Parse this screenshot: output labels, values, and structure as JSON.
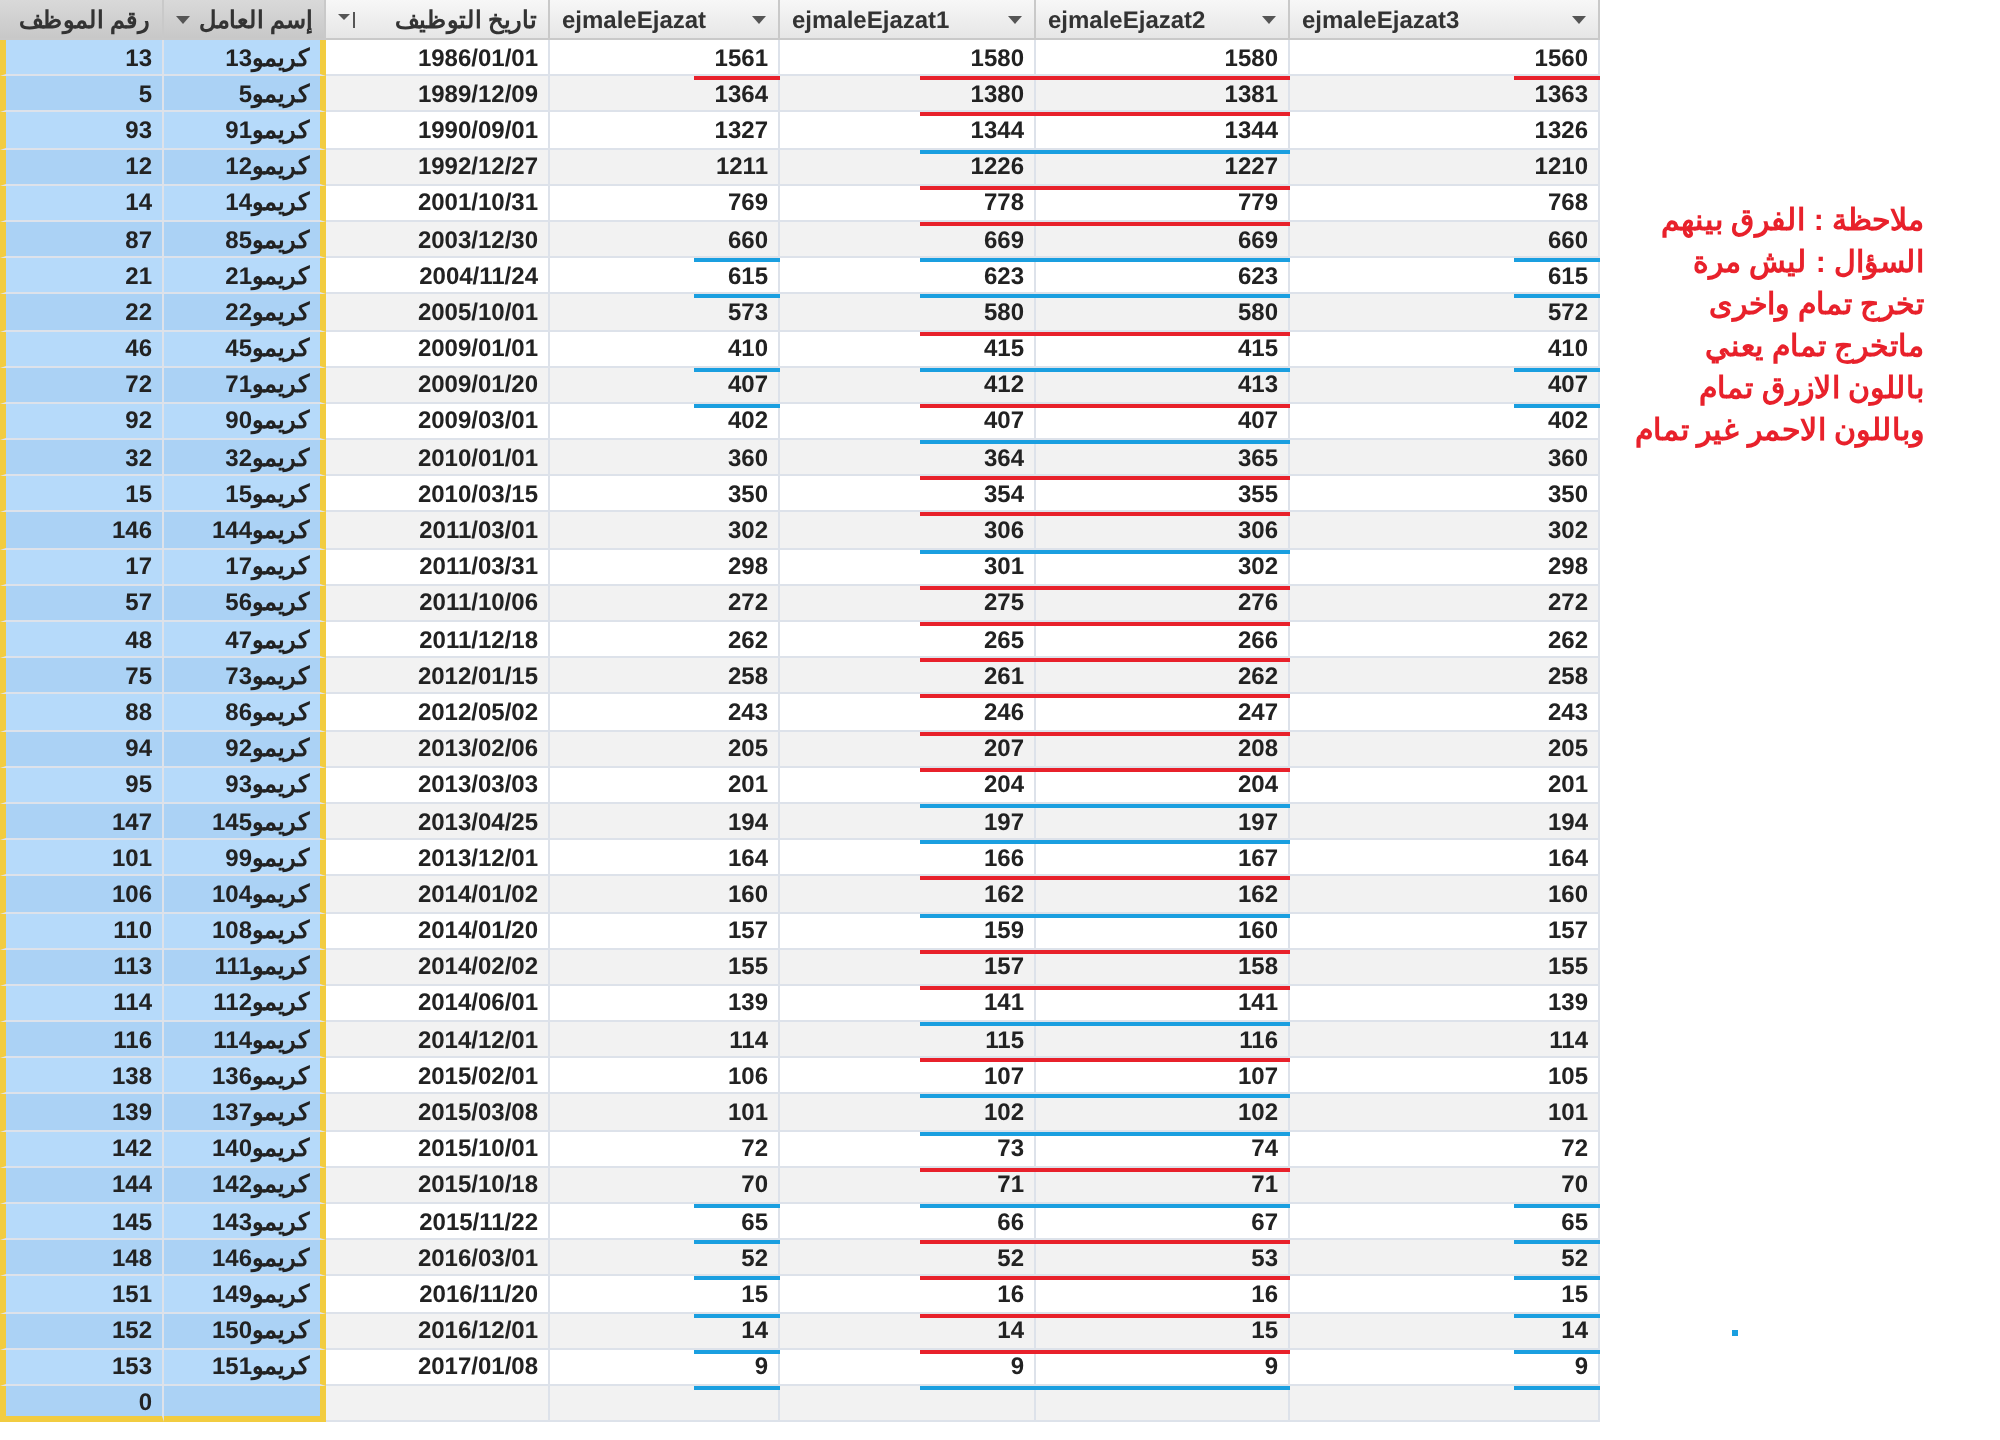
{
  "table": {
    "columns": [
      {
        "label": "رقم الموظف",
        "selected": true
      },
      {
        "label": "إسم العامل",
        "selected": true
      },
      {
        "label": "تاريخ التوظيف",
        "selected": false
      },
      {
        "label": "ejmaleEjazat",
        "selected": false
      },
      {
        "label": "ejmaleEjazat1",
        "selected": false
      },
      {
        "label": "ejmaleEjazat2",
        "selected": false
      },
      {
        "label": "ejmaleEjazat3",
        "selected": false
      }
    ],
    "rows": [
      {
        "cells": [
          "13",
          "كريمو13",
          "1986/01/01",
          "1561",
          "1580",
          "1580",
          "1560"
        ],
        "color": "#e8212b",
        "outer_mark": {
          "color": "#e8212b"
        }
      },
      {
        "cells": [
          "5",
          "كريمو5",
          "1989/12/09",
          "1364",
          "1380",
          "1381",
          "1363"
        ],
        "color": "#e8212b"
      },
      {
        "cells": [
          "93",
          "كريمو91",
          "1990/09/01",
          "1327",
          "1344",
          "1344",
          "1326"
        ],
        "color": "#1a9fe0"
      },
      {
        "cells": [
          "12",
          "كريمو12",
          "1992/12/27",
          "1211",
          "1226",
          "1227",
          "1210"
        ],
        "color": "#e8212b"
      },
      {
        "cells": [
          "14",
          "كريمو14",
          "2001/10/31",
          "769",
          "778",
          "779",
          "768"
        ],
        "color": "#e8212b"
      },
      {
        "cells": [
          "87",
          "كريمو85",
          "2003/12/30",
          "660",
          "669",
          "669",
          "660"
        ],
        "color": "#1a9fe0",
        "outer_mark": {
          "color": "#1a9fe0"
        }
      },
      {
        "cells": [
          "21",
          "كريمو21",
          "2004/11/24",
          "615",
          "623",
          "623",
          "615"
        ],
        "color": "#1a9fe0",
        "outer_mark": {
          "color": "#1a9fe0"
        }
      },
      {
        "cells": [
          "22",
          "كريمو22",
          "2005/10/01",
          "573",
          "580",
          "580",
          "572"
        ],
        "color": "#e8212b"
      },
      {
        "cells": [
          "46",
          "كريمو45",
          "2009/01/01",
          "410",
          "415",
          "415",
          "410"
        ],
        "color": "#1a9fe0",
        "outer_mark": {
          "color": "#1a9fe0"
        }
      },
      {
        "cells": [
          "72",
          "كريمو71",
          "2009/01/20",
          "407",
          "412",
          "413",
          "407"
        ],
        "color": "#e8212b",
        "outer_mark": {
          "color": "#1a9fe0"
        }
      },
      {
        "cells": [
          "92",
          "كريمو90",
          "2009/03/01",
          "402",
          "407",
          "407",
          "402"
        ],
        "color": "#1a9fe0"
      },
      {
        "cells": [
          "32",
          "كريمو32",
          "2010/01/01",
          "360",
          "364",
          "365",
          "360"
        ],
        "color": "#e8212b"
      },
      {
        "cells": [
          "15",
          "كريمو15",
          "2010/03/15",
          "350",
          "354",
          "355",
          "350"
        ],
        "color": "#e8212b"
      },
      {
        "cells": [
          "146",
          "كريمو144",
          "2011/03/01",
          "302",
          "306",
          "306",
          "302"
        ],
        "color": "#1a9fe0"
      },
      {
        "cells": [
          "17",
          "كريمو17",
          "2011/03/31",
          "298",
          "301",
          "302",
          "298"
        ],
        "color": "#e8212b"
      },
      {
        "cells": [
          "57",
          "كريمو56",
          "2011/10/06",
          "272",
          "275",
          "276",
          "272"
        ],
        "color": "#e8212b"
      },
      {
        "cells": [
          "48",
          "كريمو47",
          "2011/12/18",
          "262",
          "265",
          "266",
          "262"
        ],
        "color": "#e8212b"
      },
      {
        "cells": [
          "75",
          "كريمو73",
          "2012/01/15",
          "258",
          "261",
          "262",
          "258"
        ],
        "color": "#e8212b"
      },
      {
        "cells": [
          "88",
          "كريمو86",
          "2012/05/02",
          "243",
          "246",
          "247",
          "243"
        ],
        "color": "#e8212b"
      },
      {
        "cells": [
          "94",
          "كريمو92",
          "2013/02/06",
          "205",
          "207",
          "208",
          "205"
        ],
        "color": "#e8212b"
      },
      {
        "cells": [
          "95",
          "كريمو93",
          "2013/03/03",
          "201",
          "204",
          "204",
          "201"
        ],
        "color": "#1a9fe0"
      },
      {
        "cells": [
          "147",
          "كريمو145",
          "2013/04/25",
          "194",
          "197",
          "197",
          "194"
        ],
        "color": "#1a9fe0"
      },
      {
        "cells": [
          "101",
          "كريمو99",
          "2013/12/01",
          "164",
          "166",
          "167",
          "164"
        ],
        "color": "#e8212b"
      },
      {
        "cells": [
          "106",
          "كريمو104",
          "2014/01/02",
          "160",
          "162",
          "162",
          "160"
        ],
        "color": "#1a9fe0"
      },
      {
        "cells": [
          "110",
          "كريمو108",
          "2014/01/20",
          "157",
          "159",
          "160",
          "157"
        ],
        "color": "#e8212b"
      },
      {
        "cells": [
          "113",
          "كريمو111",
          "2014/02/02",
          "155",
          "157",
          "158",
          "155"
        ],
        "color": "#e8212b"
      },
      {
        "cells": [
          "114",
          "كريمو112",
          "2014/06/01",
          "139",
          "141",
          "141",
          "139"
        ],
        "color": "#1a9fe0"
      },
      {
        "cells": [
          "116",
          "كريمو114",
          "2014/12/01",
          "114",
          "115",
          "116",
          "114"
        ],
        "color": "#e8212b"
      },
      {
        "cells": [
          "138",
          "كريمو136",
          "2015/02/01",
          "106",
          "107",
          "107",
          "105"
        ],
        "color": "#1a9fe0"
      },
      {
        "cells": [
          "139",
          "كريمو137",
          "2015/03/08",
          "101",
          "102",
          "102",
          "101"
        ],
        "color": "#1a9fe0"
      },
      {
        "cells": [
          "142",
          "كريمو140",
          "2015/10/01",
          "72",
          "73",
          "74",
          "72"
        ],
        "color": "#e8212b"
      },
      {
        "cells": [
          "144",
          "كريمو142",
          "2015/10/18",
          "70",
          "71",
          "71",
          "70"
        ],
        "color": "#1a9fe0",
        "outer_mark": {
          "color": "#1a9fe0"
        }
      },
      {
        "cells": [
          "145",
          "كريمو143",
          "2015/11/22",
          "65",
          "66",
          "67",
          "65"
        ],
        "color": "#e8212b",
        "outer_mark": {
          "color": "#1a9fe0"
        }
      },
      {
        "cells": [
          "148",
          "كريمو146",
          "2016/03/01",
          "52",
          "52",
          "53",
          "52"
        ],
        "color": "#e8212b",
        "outer_mark": {
          "color": "#1a9fe0"
        }
      },
      {
        "cells": [
          "151",
          "كريمو149",
          "2016/11/20",
          "15",
          "16",
          "16",
          "15"
        ],
        "color": "#e8212b",
        "outer_mark": {
          "color": "#1a9fe0"
        }
      },
      {
        "cells": [
          "152",
          "كريمو150",
          "2016/12/01",
          "14",
          "14",
          "15",
          "14"
        ],
        "color": "#e8212b",
        "outer_mark": {
          "color": "#1a9fe0"
        }
      },
      {
        "cells": [
          "153",
          "كريمو151",
          "2017/01/08",
          "9",
          "9",
          "9",
          "9"
        ],
        "color": "#1a9fe0",
        "outer_mark": {
          "color": "#1a9fe0"
        }
      }
    ],
    "new_row": {
      "id": "0"
    }
  },
  "note": {
    "text": "ملاحظة : الفرق بينهم السؤال : ليش مرة تخرج تمام واخرى ماتخرج تمام يعني باللون الازرق تمام وباللون الاحمر غير تمام"
  }
}
